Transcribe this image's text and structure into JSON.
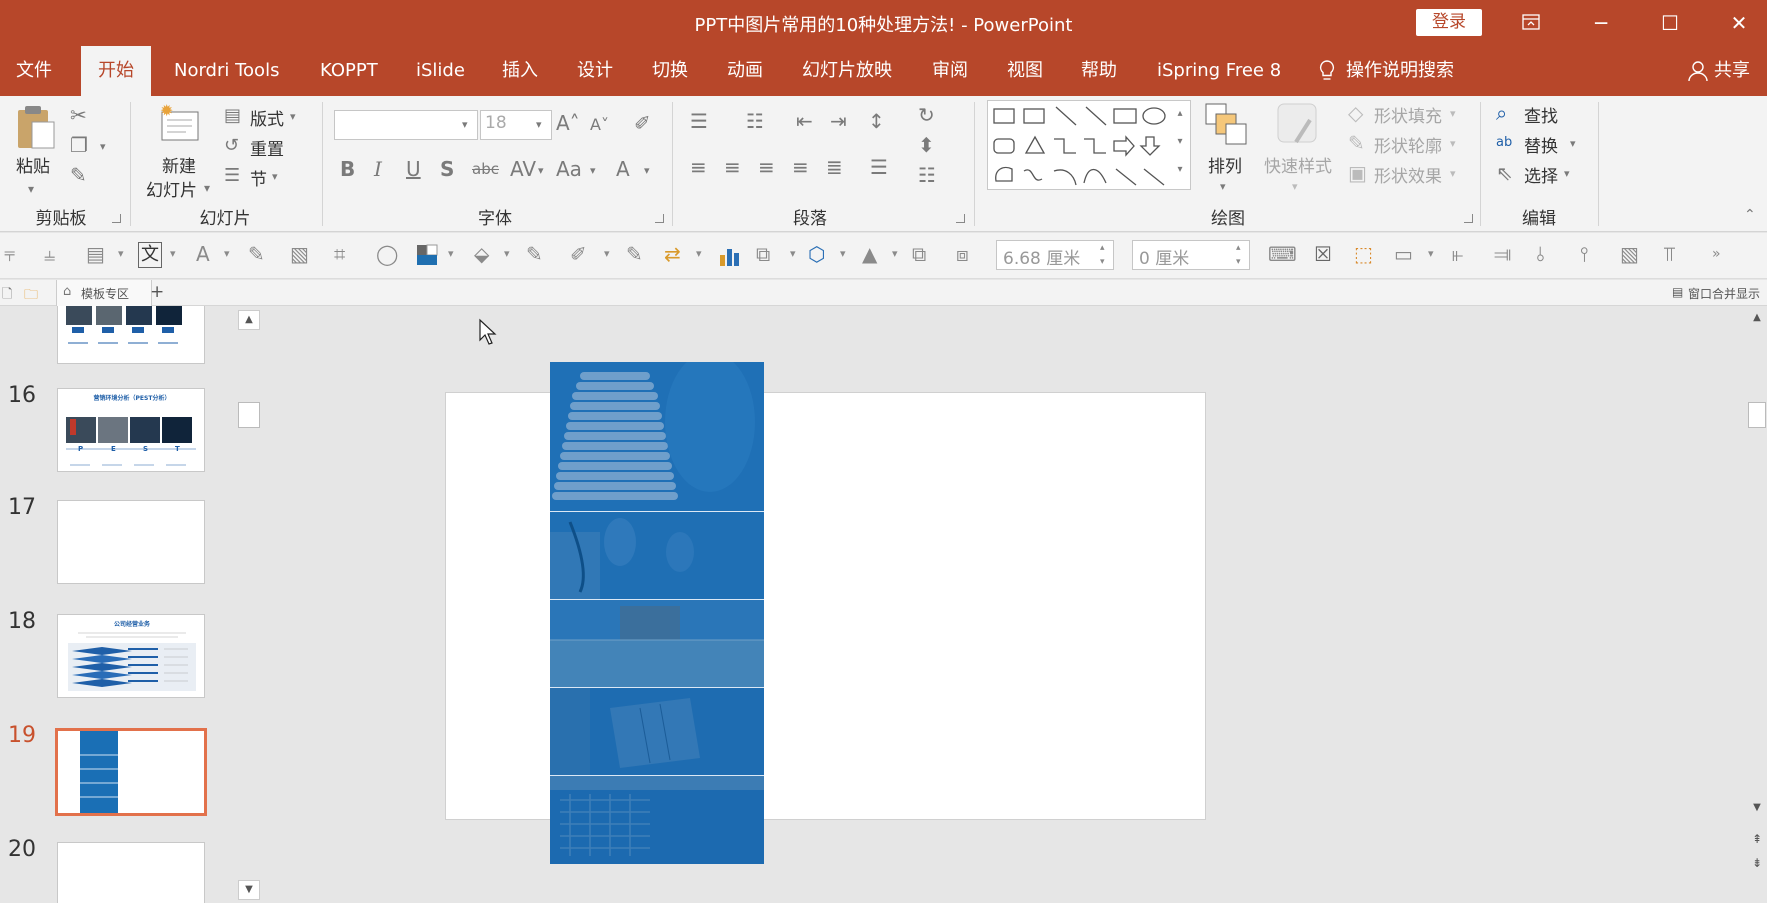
{
  "window": {
    "title": "PPT中图片常用的10种处理方法!  - PowerPoint",
    "login_label": "登录",
    "controls": [
      "restore-ribbon",
      "minimize",
      "maximize",
      "close"
    ]
  },
  "tabs": [
    {
      "label": "文件",
      "active": false
    },
    {
      "label": "开始",
      "active": true
    },
    {
      "label": "Nordri Tools",
      "active": false
    },
    {
      "label": "KOPPT",
      "active": false
    },
    {
      "label": "iSlide",
      "active": false
    },
    {
      "label": "插入",
      "active": false
    },
    {
      "label": "设计",
      "active": false
    },
    {
      "label": "切换",
      "active": false
    },
    {
      "label": "动画",
      "active": false
    },
    {
      "label": "幻灯片放映",
      "active": false
    },
    {
      "label": "审阅",
      "active": false
    },
    {
      "label": "视图",
      "active": false
    },
    {
      "label": "帮助",
      "active": false
    },
    {
      "label": "iSpring Free 8",
      "active": false
    }
  ],
  "tell_me": "操作说明搜索",
  "share": "共享",
  "ribbon": {
    "clipboard": {
      "group": "剪贴板",
      "paste": "粘贴"
    },
    "slides": {
      "group": "幻灯片",
      "new_slide_1": "新建",
      "new_slide_2": "幻灯片",
      "layout": "版式",
      "reset": "重置",
      "section": "节"
    },
    "font": {
      "group": "字体",
      "font_name": "",
      "font_size": "18"
    },
    "paragraph": {
      "group": "段落"
    },
    "drawing": {
      "group": "绘图",
      "arrange": "排列",
      "quick_styles": "快速样式",
      "shape_fill": "形状填充",
      "shape_outline": "形状轮廓",
      "shape_effects": "形状效果"
    },
    "editing": {
      "group": "编辑",
      "find": "查找",
      "replace": "替换",
      "select": "选择"
    }
  },
  "format_bar": {
    "text_tool": "文",
    "height_value": "6.68 厘米",
    "width_value": "0 厘米"
  },
  "doc_tabs": {
    "template_tab": "模板专区",
    "merge_label": "窗口合并显示"
  },
  "thumbnails": [
    {
      "number": "",
      "kind": "pest-partial"
    },
    {
      "number": "16",
      "kind": "pest"
    },
    {
      "number": "17",
      "kind": "blank"
    },
    {
      "number": "18",
      "kind": "layers"
    },
    {
      "number": "19",
      "kind": "strip",
      "selected": true
    },
    {
      "number": "20",
      "kind": "blank"
    }
  ],
  "thumb_text": {
    "pest_title": "营销环境分析（PEST分析）",
    "pest_letters": [
      "P",
      "E",
      "S",
      "T"
    ],
    "layers_title": "公司经营业务"
  },
  "colors": {
    "brand": "#b7472a",
    "ribbon_bg": "#f3f3f3",
    "selected_thumb": "#e2714b",
    "image_blue": "#1a6fb5"
  }
}
